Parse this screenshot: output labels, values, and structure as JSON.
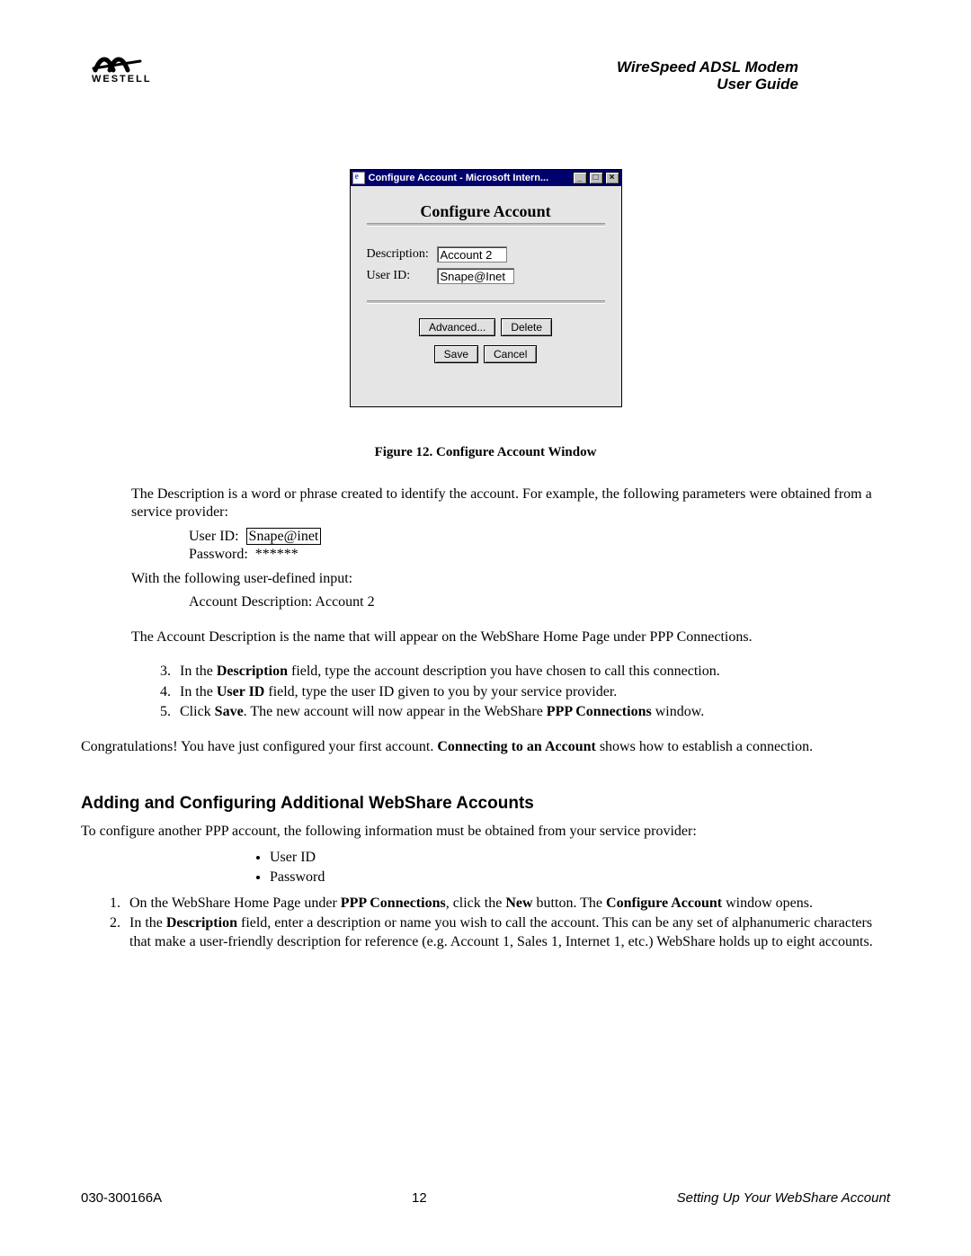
{
  "header": {
    "brand": "WESTELL",
    "title_line1": "WireSpeed ADSL Modem",
    "title_line2": "User Guide"
  },
  "window": {
    "title": "Configure Account - Microsoft Intern...",
    "min_glyph": "_",
    "max_glyph": "□",
    "close_glyph": "×",
    "heading": "Configure Account",
    "labels": {
      "description": "Description:",
      "user_id": "User ID:"
    },
    "fields": {
      "description": "Account 2",
      "user_id": "Snape@Inet"
    },
    "buttons": {
      "advanced": "Advanced...",
      "delete": "Delete",
      "save": "Save",
      "cancel": "Cancel"
    }
  },
  "figure_caption": "Figure 12. Configure Account Window",
  "body": {
    "p1": "The Description is a word or phrase created to identify the account. For example, the following parameters were obtained from a service provider:",
    "example": {
      "user_id_label": "User ID:",
      "user_id_value": "Snape@inet",
      "password_label": "Password:",
      "password_value": "******"
    },
    "p2_line1": "With the following user-defined input:",
    "p2_line2": "Account Description:  Account 2",
    "p3": "The Account Description is the name that will appear on the WebShare Home Page under PPP Connections.",
    "ol": {
      "i3a": "In the ",
      "i3b": "Description",
      "i3c": " field, type the account description you have chosen to call this connection.",
      "i4a": "In the ",
      "i4b": "User ID",
      "i4c": " field, type the user ID given to you by your service provider.",
      "i5a": "Click ",
      "i5b": "Save",
      "i5c": ". The new account will now appear in the WebShare ",
      "i5d": "PPP Connections",
      "i5e": " window."
    },
    "p4a": "Congratulations! You have just configured your first account. ",
    "p4b": "Connecting to an Account",
    "p4c": " shows how to establish a connection."
  },
  "section2": {
    "heading": "Adding and Configuring Additional WebShare Accounts",
    "p1": "To configure another PPP account, the following information must be obtained from your service provider:",
    "bullets": {
      "b1": "User ID",
      "b2": "Password"
    },
    "ol": {
      "i1a": "On the WebShare Home Page under ",
      "i1b": "PPP Connections",
      "i1c": ", click the ",
      "i1d": "New",
      "i1e": " button. The ",
      "i1f": "Configure Account",
      "i1g": " window opens.",
      "i2a": "In the ",
      "i2b": "Description",
      "i2c": " field, enter a description or name you wish to call the account.  This can be any set of alphanumeric characters that make a user-friendly description for reference (e.g. Account 1, Sales 1, Internet 1, etc.) WebShare holds up to eight accounts."
    }
  },
  "footer": {
    "left": "030-300166A",
    "center": "12",
    "right": "Setting Up Your WebShare Account"
  }
}
